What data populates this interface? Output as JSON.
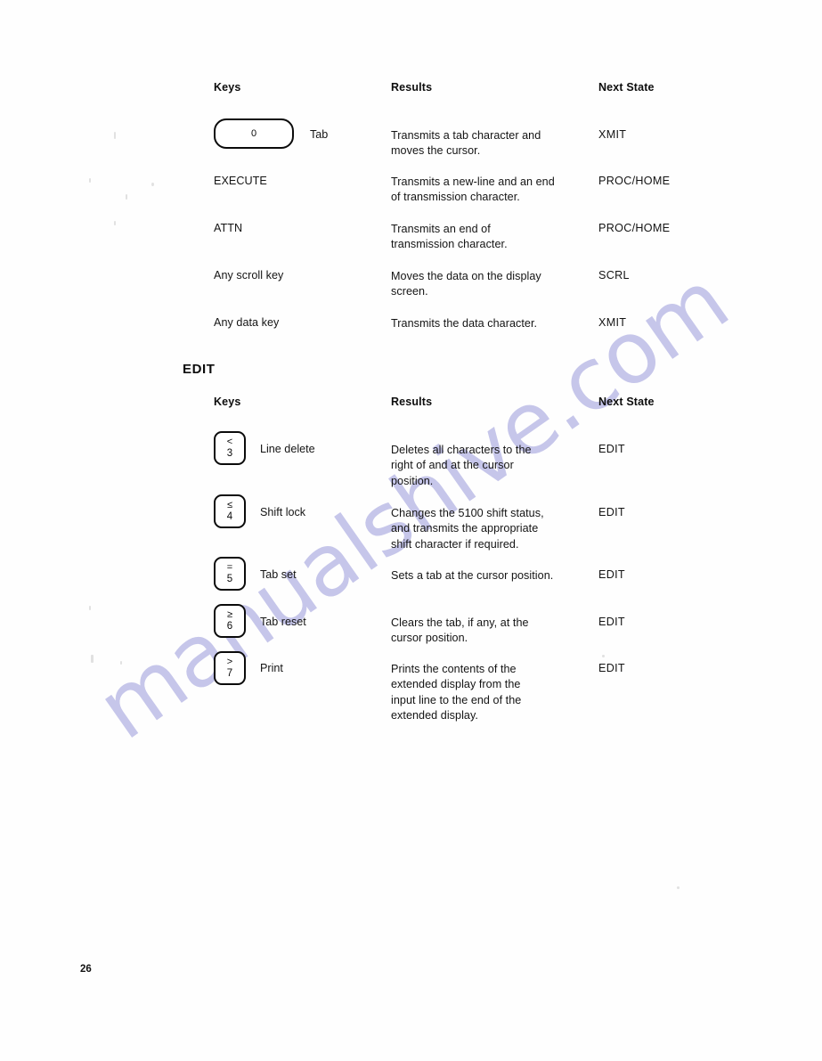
{
  "page": {
    "number": "26",
    "watermark": "manualshive.com",
    "watermark_color": "#c6c6ea",
    "background_color": "#fefefe",
    "ink_color": "#141414"
  },
  "columns": {
    "keys": "Keys",
    "results": "Results",
    "next_state": "Next State"
  },
  "sections": [
    {
      "title": "",
      "header": {
        "keys": "Keys",
        "results": "Results",
        "next_state": "Next State"
      },
      "rows": [
        {
          "key_type": "keycap-wide",
          "keycap": {
            "symbol": "",
            "number": "0"
          },
          "key_label": "Tab",
          "results": "Transmits a tab character and moves the cursor.",
          "next_state": "XMIT"
        },
        {
          "key_type": "text",
          "key_label": "EXECUTE",
          "results": "Transmits a new-line and an end of transmission character.",
          "next_state": "PROC/HOME"
        },
        {
          "key_type": "text",
          "key_label": "ATTN",
          "results": "Transmits an end of transmission character.",
          "next_state": "PROC/HOME"
        },
        {
          "key_type": "text",
          "key_label": "Any scroll key",
          "results": "Moves the data on the display screen.",
          "next_state": "SCRL"
        },
        {
          "key_type": "text",
          "key_label": "Any data key",
          "results": "Transmits the data character.",
          "next_state": "XMIT"
        }
      ]
    },
    {
      "title": "EDIT",
      "header": {
        "keys": "Keys",
        "results": "Results",
        "next_state": "Next State"
      },
      "rows": [
        {
          "key_type": "keycap-small",
          "keycap": {
            "symbol": "<",
            "number": "3"
          },
          "key_label": "Line delete",
          "results": "Deletes all characters to the right of and at the cursor position.",
          "next_state": "EDIT"
        },
        {
          "key_type": "keycap-small",
          "keycap": {
            "symbol": "≤",
            "number": "4"
          },
          "key_label": "Shift lock",
          "results": "Changes the 5100 shift status, and transmits the appropriate shift character if required.",
          "next_state": "EDIT"
        },
        {
          "key_type": "keycap-small",
          "keycap": {
            "symbol": "=",
            "number": "5"
          },
          "key_label": "Tab set",
          "results": "Sets a tab at the cursor position.",
          "next_state": "EDIT"
        },
        {
          "key_type": "keycap-small",
          "keycap": {
            "symbol": "≥",
            "number": "6"
          },
          "key_label": "Tab reset",
          "results": "Clears the tab, if any, at the cursor position.",
          "next_state": "EDIT"
        },
        {
          "key_type": "keycap-small",
          "keycap": {
            "symbol": ">",
            "number": "7"
          },
          "key_label": "Print",
          "results": "Prints the contents of the extended display from the input line to the end of the extended display.",
          "next_state": "EDIT"
        }
      ]
    }
  ],
  "results_lines": {
    "s0r0": [
      "Transmits a tab character and",
      "moves the cursor."
    ],
    "s0r1": [
      "Transmits a new-line and an end",
      "of transmission character."
    ],
    "s0r2": [
      "Transmits an end of",
      "transmission character."
    ],
    "s0r3": [
      "Moves the data on the display",
      "screen."
    ],
    "s0r4": [
      "Transmits the data character."
    ],
    "s1r0": [
      "Deletes all characters to the",
      "right of and at the cursor",
      "position."
    ],
    "s1r1": [
      "Changes the 5100 shift status,",
      "and transmits the appropriate",
      "shift character if required."
    ],
    "s1r2": [
      "Sets a tab at the cursor position."
    ],
    "s1r3": [
      "Clears the tab, if any, at the",
      "cursor position."
    ],
    "s1r4": [
      "Prints the contents of the",
      "extended display from the",
      "input line to the end of the",
      "extended display."
    ]
  }
}
